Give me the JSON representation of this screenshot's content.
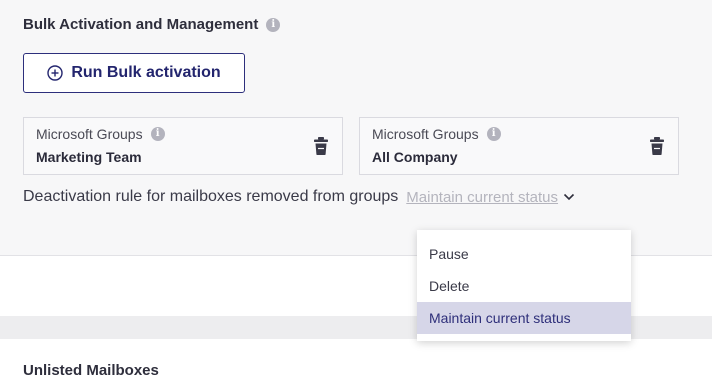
{
  "section": {
    "title": "Bulk Activation and Management",
    "info_icon": "info-icon"
  },
  "run_button": {
    "label": "Run Bulk activation",
    "icon": "plus-circle-icon"
  },
  "groups": [
    {
      "label": "Microsoft Groups",
      "value": "Marketing Team",
      "action_icon": "trash-icon"
    },
    {
      "label": "Microsoft Groups",
      "value": "All Company",
      "action_icon": "trash-icon"
    }
  ],
  "deactivation_rule": {
    "label": "Deactivation rule for mailboxes removed from groups",
    "selected": "Maintain current status",
    "icon": "chevron-down-icon"
  },
  "dropdown": {
    "options": [
      "Pause",
      "Delete",
      "Maintain current status"
    ],
    "selected_index": 2
  },
  "bottom_section": {
    "title": "Unlisted Mailboxes"
  },
  "colors": {
    "accent": "#2d2f7c",
    "selected_bg": "#d6d6e8",
    "panel_bg": "#f7f7f8",
    "muted_text": "#b4b4bd"
  }
}
